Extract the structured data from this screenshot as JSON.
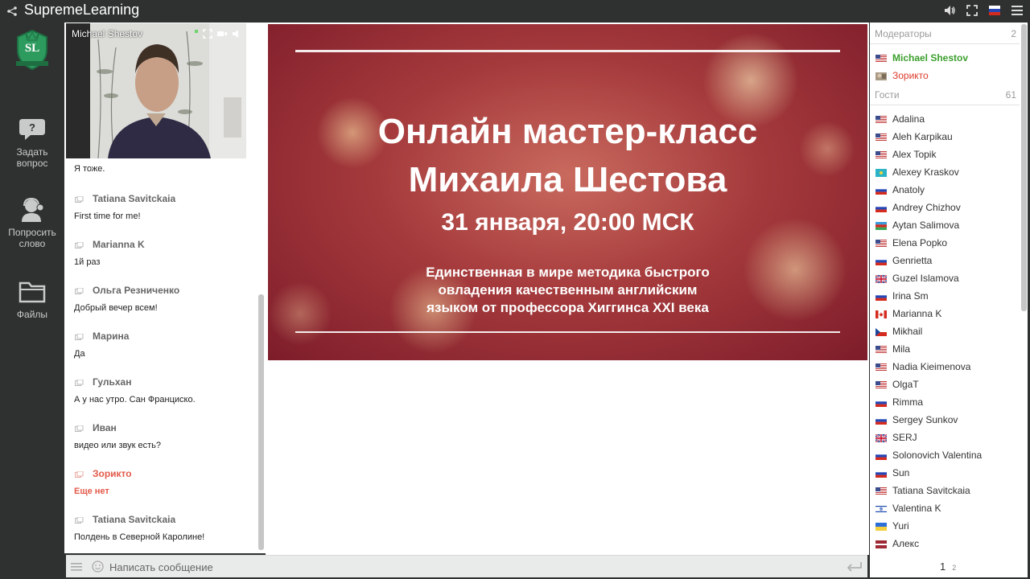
{
  "app": {
    "title": "SupremeLearning",
    "logo_text": "SL"
  },
  "rail": {
    "items": [
      {
        "label_line1": "Задать",
        "label_line2": "вопрос"
      },
      {
        "label_line1": "Попросить",
        "label_line2": "слово"
      },
      {
        "label_line1": "Файлы",
        "label_line2": ""
      }
    ]
  },
  "video": {
    "name": "Michael Shestov"
  },
  "chat": {
    "messages": [
      {
        "author": "",
        "text": "Я тоже."
      },
      {
        "author": "Tatiana Savitckaia",
        "text": "First time for me!"
      },
      {
        "author": "Marianna K",
        "text": "1й раз"
      },
      {
        "author": "Ольга Резниченко",
        "text": "Добрый вечер всем!"
      },
      {
        "author": "Марина",
        "text": "Да"
      },
      {
        "author": "Гульхан",
        "text": "А у нас утро. Сан Франциско."
      },
      {
        "author": "Иван",
        "text": "видео или звук есть?"
      },
      {
        "author": "Зорикто",
        "text": "Еще нет",
        "moderator": true
      },
      {
        "author": "Tatiana Savitckaia",
        "text": "Полдень в Северной Каролине!"
      }
    ],
    "input_placeholder": "Написать сообщение"
  },
  "slide": {
    "title_line1": "Онлайн мастер-класс",
    "title_line2": "Михаила Шестова",
    "date": "31 января, 20:00 МСК",
    "sub_line1": "Единственная в мире методика быстрого",
    "sub_line2": "овладения качественным английским",
    "sub_line3": "языком от профессора Хиггинса XXI века"
  },
  "participants": {
    "moderators_label": "Модераторы",
    "moderators_count": "2",
    "moderators": [
      {
        "name": "Michael Shestov",
        "flag": "us",
        "style": "green"
      },
      {
        "name": "Зорикто",
        "flag": "avatar",
        "style": "red"
      }
    ],
    "guests_label": "Гости",
    "guests_count": "61",
    "guests": [
      {
        "name": "Adalina",
        "flag": "us"
      },
      {
        "name": "Aleh Karpikau",
        "flag": "us"
      },
      {
        "name": "Alex Topik",
        "flag": "us"
      },
      {
        "name": "Alexey Kraskov",
        "flag": "kz"
      },
      {
        "name": "Anatoly",
        "flag": "ru"
      },
      {
        "name": "Andrey Chizhov",
        "flag": "ru"
      },
      {
        "name": "Aytan Salimova",
        "flag": "az"
      },
      {
        "name": "Elena Popko",
        "flag": "us"
      },
      {
        "name": "Genrietta",
        "flag": "ru"
      },
      {
        "name": "Guzel Islamova",
        "flag": "gb"
      },
      {
        "name": "Irina Sm",
        "flag": "ru"
      },
      {
        "name": "Marianna K",
        "flag": "ca"
      },
      {
        "name": "Mikhail",
        "flag": "cz"
      },
      {
        "name": "Mila",
        "flag": "us"
      },
      {
        "name": "Nadia Kieimenova",
        "flag": "us"
      },
      {
        "name": "OlgaT",
        "flag": "us"
      },
      {
        "name": "Rimma",
        "flag": "ru"
      },
      {
        "name": "Sergey Sunkov",
        "flag": "ru"
      },
      {
        "name": "SERJ",
        "flag": "gb"
      },
      {
        "name": "Solonovich Valentina",
        "flag": "ru"
      },
      {
        "name": "Sun",
        "flag": "ru"
      },
      {
        "name": "Tatiana Savitckaia",
        "flag": "us"
      },
      {
        "name": "Valentina K",
        "flag": "il"
      },
      {
        "name": "Yuri",
        "flag": "ua"
      },
      {
        "name": "Алекс",
        "flag": "lv"
      }
    ],
    "pages": [
      "1",
      "2"
    ]
  },
  "colors": {
    "moderator_green": "#3c9f2e",
    "moderator_red": "#dd3b2c",
    "chrome": "#2f3131"
  }
}
